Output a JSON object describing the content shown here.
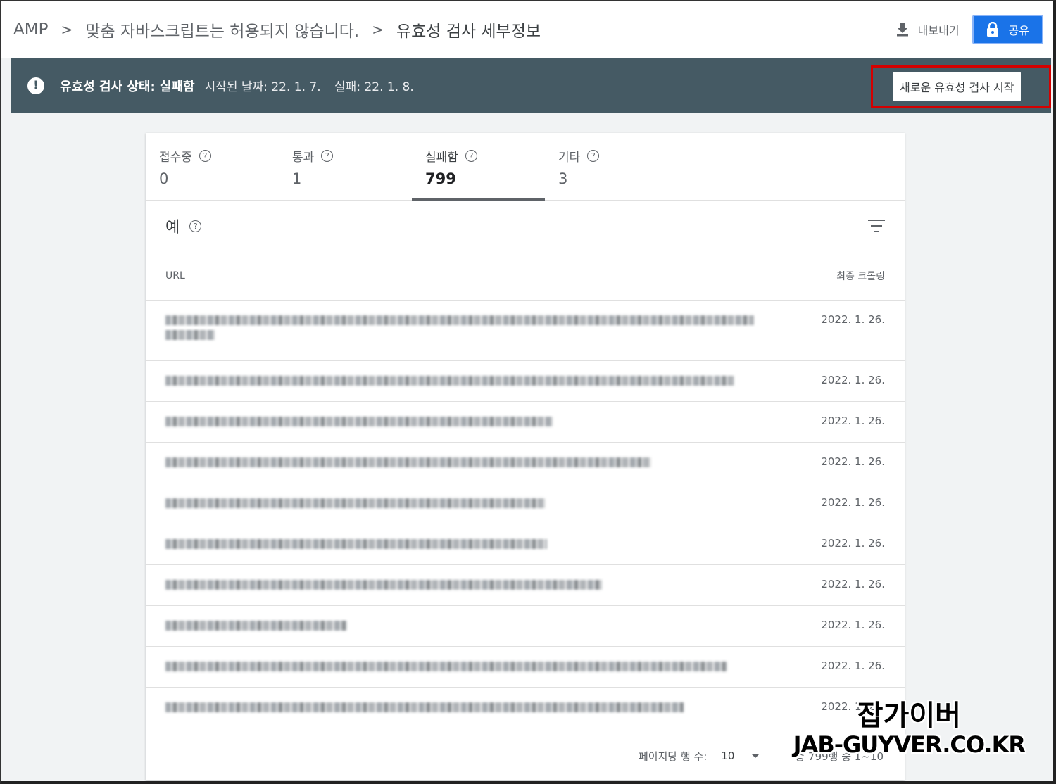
{
  "breadcrumb": {
    "items": [
      "AMP",
      "맞춤 자바스크립트는 허용되지 않습니다.",
      "유효성 검사 세부정보"
    ],
    "separator": ">"
  },
  "toolbar": {
    "export_label": "내보내기",
    "share_label": "공유"
  },
  "status": {
    "label": "유효성 검사 상태: 실패함",
    "started": "시작된 날짜: 22. 1. 7.",
    "failed": "실패: 22. 1. 8.",
    "validate_button": "새로운 유효성 검사 시작"
  },
  "tabs": [
    {
      "label": "접수중",
      "count": "0"
    },
    {
      "label": "통과",
      "count": "1"
    },
    {
      "label": "실패함",
      "count": "799"
    },
    {
      "label": "기타",
      "count": "3"
    }
  ],
  "section": {
    "title": "예"
  },
  "table": {
    "headers": {
      "url": "URL",
      "crawl": "최종 크롤링"
    },
    "rows": [
      {
        "url": "",
        "date": "2022. 1. 26."
      },
      {
        "url": "",
        "date": "2022. 1. 26."
      },
      {
        "url": "",
        "date": "2022. 1. 26."
      },
      {
        "url": "",
        "date": "2022. 1. 26."
      },
      {
        "url": "",
        "date": "2022. 1. 26."
      },
      {
        "url": "",
        "date": "2022. 1. 26."
      },
      {
        "url": "",
        "date": "2022. 1. 26."
      },
      {
        "url": "",
        "date": "2022. 1. 26."
      },
      {
        "url": "",
        "date": "2022. 1. 26."
      },
      {
        "url": "",
        "date": "2022. 1. 26."
      }
    ]
  },
  "pagination": {
    "rows_per_page_label": "페이지당 행 수:",
    "rows_per_page_value": "10",
    "range": "총 799행 중 1~10"
  },
  "watermark": {
    "line1": "잡가이버",
    "line2": "JAB-GUYVER.CO.KR"
  }
}
